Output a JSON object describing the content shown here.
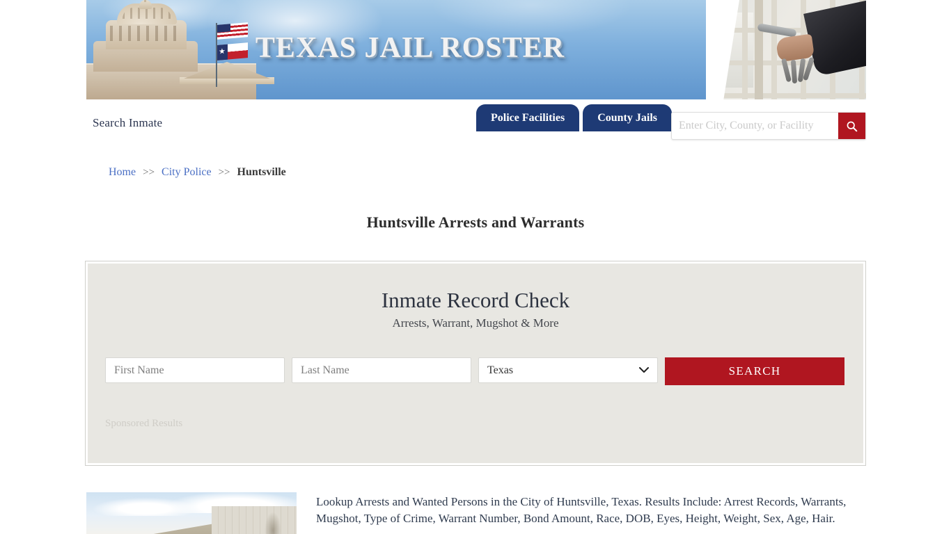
{
  "banner": {
    "title_main": "TEXAS JAIL ROSTER",
    "title_words": [
      "Texas",
      "Jail",
      "Roster"
    ],
    "alt": "texas-capitol-and-jail-door-banner"
  },
  "nav": {
    "search_inmate_label": "Search Inmate",
    "tabs": [
      {
        "label": "Police Facilities",
        "active": true
      },
      {
        "label": "County Jails",
        "active": false
      }
    ],
    "search": {
      "value": "",
      "placeholder": "Enter City, County, or Facility",
      "button_icon": "search-icon"
    }
  },
  "breadcrumb": {
    "items": [
      {
        "label": "Home",
        "link": true
      },
      {
        "label": "City Police",
        "link": true
      },
      {
        "label": "Huntsville",
        "link": false
      }
    ],
    "separator": ">>"
  },
  "page_title": "Huntsville Arrests and Warrants",
  "panel": {
    "heading": "Inmate Record Check",
    "subheading": "Arrests, Warrant, Mugshot & More",
    "form": {
      "first_name": {
        "value": "",
        "placeholder": "First Name"
      },
      "last_name": {
        "value": "",
        "placeholder": "Last Name"
      },
      "state": {
        "selected": "Texas",
        "options": [
          "Texas"
        ]
      },
      "search_button": "SEARCH"
    },
    "sponsored_label": "Sponsored Results"
  },
  "content": {
    "image_alt": "huntsville-jail-building-photo",
    "description": "Lookup Arrests and Wanted Persons in the City of Huntsville, Texas. Results Include: Arrest Records, Warrants, Mugshot, Type of Crime, Warrant Number, Bond Amount, Race, DOB, Eyes, Height, Weight, Sex, Age, Hair."
  },
  "colors": {
    "navy": "#1e3a75",
    "red": "#b01620",
    "panel_bg": "#e8e7e2",
    "link_blue": "#4a6fc4",
    "banner_sky": "#7fb0dd"
  }
}
